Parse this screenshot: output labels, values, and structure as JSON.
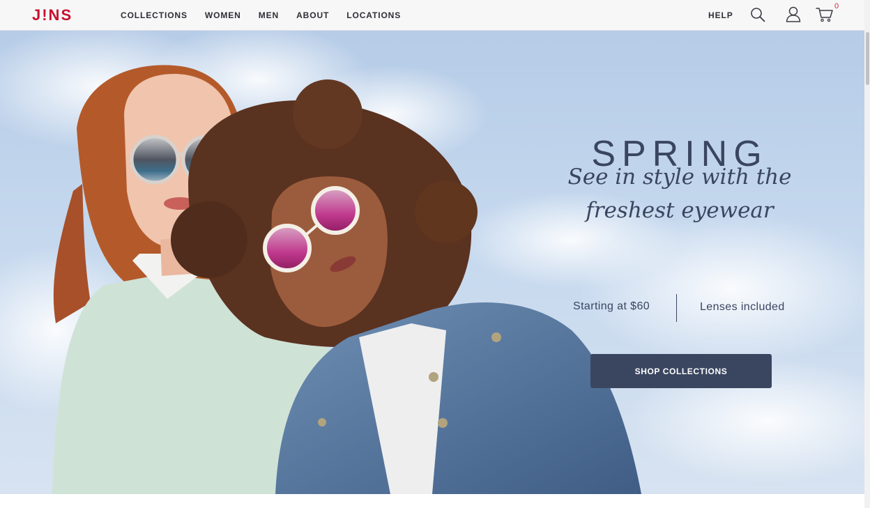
{
  "header": {
    "logo_text": "J!NS",
    "nav": [
      "COLLECTIONS",
      "WOMEN",
      "MEN",
      "ABOUT",
      "LOCATIONS"
    ],
    "help_label": "HELP",
    "icons": [
      "search-icon",
      "account-icon",
      "cart-icon"
    ],
    "cart_count": "0"
  },
  "hero": {
    "title": "SPRING",
    "tagline": "See in style with the freshest eyewear",
    "price_text": "Starting at $60",
    "lenses_text": "Lenses included",
    "cta_label": "SHOP COLLECTIONS"
  },
  "colors": {
    "brand": "#c8102e",
    "text_dark": "#3a4560",
    "cta_bg": "#3a4660",
    "sky": "#c5d8ee"
  }
}
